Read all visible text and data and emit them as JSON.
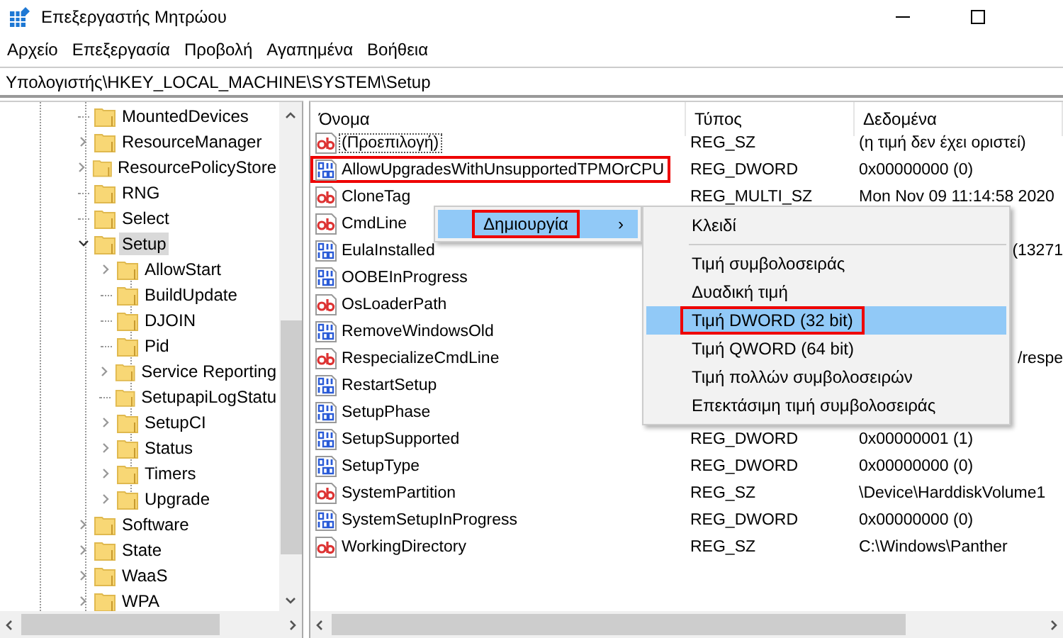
{
  "window": {
    "title": "Επεξεργαστής Μητρώου"
  },
  "menu_bar": [
    "Αρχείο",
    "Επεξεργασία",
    "Προβολή",
    "Αγαπημένα",
    "Βοήθεια"
  ],
  "address": "Υπολογιστής\\HKEY_LOCAL_MACHINE\\SYSTEM\\Setup",
  "tree": [
    {
      "label": "MountedDevices",
      "expandable": false,
      "expanded": false,
      "selected": false
    },
    {
      "label": "ResourceManager",
      "expandable": true,
      "expanded": false,
      "selected": false
    },
    {
      "label": "ResourcePolicyStore",
      "expandable": true,
      "expanded": false,
      "selected": false
    },
    {
      "label": "RNG",
      "expandable": false,
      "expanded": false,
      "selected": false
    },
    {
      "label": "Select",
      "expandable": false,
      "expanded": false,
      "selected": false
    },
    {
      "label": "Setup",
      "expandable": true,
      "expanded": true,
      "selected": true,
      "children": [
        {
          "label": "AllowStart",
          "expandable": true,
          "expanded": false,
          "selected": false
        },
        {
          "label": "BuildUpdate",
          "expandable": false,
          "expanded": false,
          "selected": false
        },
        {
          "label": "DJOIN",
          "expandable": false,
          "expanded": false,
          "selected": false
        },
        {
          "label": "Pid",
          "expandable": false,
          "expanded": false,
          "selected": false
        },
        {
          "label": "Service Reporting",
          "expandable": true,
          "expanded": false,
          "selected": false
        },
        {
          "label": "SetupapiLogStatu",
          "expandable": false,
          "expanded": false,
          "selected": false
        },
        {
          "label": "SetupCI",
          "expandable": true,
          "expanded": false,
          "selected": false
        },
        {
          "label": "Status",
          "expandable": true,
          "expanded": false,
          "selected": false
        },
        {
          "label": "Timers",
          "expandable": true,
          "expanded": false,
          "selected": false
        },
        {
          "label": "Upgrade",
          "expandable": true,
          "expanded": false,
          "selected": false
        }
      ]
    },
    {
      "label": "Software",
      "expandable": true,
      "expanded": false,
      "selected": false
    },
    {
      "label": "State",
      "expandable": true,
      "expanded": false,
      "selected": false
    },
    {
      "label": "WaaS",
      "expandable": true,
      "expanded": false,
      "selected": false
    },
    {
      "label": "WPA",
      "expandable": true,
      "expanded": false,
      "selected": false
    }
  ],
  "table": {
    "columns": [
      "Όνομα",
      "Τύπος",
      "Δεδομένα"
    ],
    "rows": [
      {
        "kind": "string",
        "name": "(Προεπιλογή)",
        "type": "REG_SZ",
        "data": "(η τιμή δεν έχει οριστεί)",
        "focused": true,
        "highlighted": false
      },
      {
        "kind": "binary",
        "name": "AllowUpgradesWithUnsupportedTPMOrCPU",
        "type": "REG_DWORD",
        "data": "0x00000000 (0)",
        "focused": false,
        "highlighted": true
      },
      {
        "kind": "string",
        "name": "CloneTag",
        "type": "REG_MULTI_SZ",
        "data": "Mon Nov 09 11:14:58 2020",
        "focused": false,
        "highlighted": false
      },
      {
        "kind": "string",
        "name": "CmdLine",
        "focused": false,
        "highlighted": false
      },
      {
        "kind": "binary",
        "name": "EulaInstalled",
        "data": "(13271",
        "focused": false,
        "highlighted": false
      },
      {
        "kind": "binary",
        "name": "OOBEInProgress",
        "focused": false,
        "highlighted": false
      },
      {
        "kind": "string",
        "name": "OsLoaderPath",
        "focused": false,
        "highlighted": false
      },
      {
        "kind": "binary",
        "name": "RemoveWindowsOld",
        "focused": false,
        "highlighted": false
      },
      {
        "kind": "string",
        "name": "RespecializeCmdLine",
        "data": "/respe",
        "focused": false,
        "highlighted": false
      },
      {
        "kind": "binary",
        "name": "RestartSetup",
        "focused": false,
        "highlighted": false
      },
      {
        "kind": "binary",
        "name": "SetupPhase",
        "focused": false,
        "highlighted": false
      },
      {
        "kind": "binary",
        "name": "SetupSupported",
        "type": "REG_DWORD",
        "data": "0x00000001 (1)",
        "focused": false,
        "highlighted": false
      },
      {
        "kind": "binary",
        "name": "SetupType",
        "type": "REG_DWORD",
        "data": "0x00000000 (0)",
        "focused": false,
        "highlighted": false
      },
      {
        "kind": "string",
        "name": "SystemPartition",
        "type": "REG_SZ",
        "data": "\\Device\\HarddiskVolume1",
        "focused": false,
        "highlighted": false
      },
      {
        "kind": "binary",
        "name": "SystemSetupInProgress",
        "type": "REG_DWORD",
        "data": "0x00000000 (0)",
        "focused": false,
        "highlighted": false
      },
      {
        "kind": "string",
        "name": "WorkingDirectory",
        "type": "REG_SZ",
        "data": "C:\\Windows\\Panther",
        "focused": false,
        "highlighted": false
      }
    ]
  },
  "context_menu": {
    "items": [
      {
        "label": "Δημιουργία",
        "arrow": "›",
        "selected": true,
        "highlighted": true
      }
    ]
  },
  "submenu": {
    "groups": [
      [
        {
          "label": "Κλειδί",
          "selected": false,
          "highlighted": false
        }
      ],
      [
        {
          "label": "Τιμή συμβολοσειράς",
          "selected": false,
          "highlighted": false
        },
        {
          "label": "Δυαδική τιμή",
          "selected": false,
          "highlighted": false
        },
        {
          "label": "Τιμή DWORD (32 bit)",
          "selected": true,
          "highlighted": true
        },
        {
          "label": "Τιμή QWORD (64 bit)",
          "selected": false,
          "highlighted": false
        },
        {
          "label": "Τιμή πολλών συμβολοσειρών",
          "selected": false,
          "highlighted": false
        },
        {
          "label": "Επεκτάσιμη τιμή συμβολοσειράς",
          "selected": false,
          "highlighted": false
        }
      ]
    ]
  }
}
